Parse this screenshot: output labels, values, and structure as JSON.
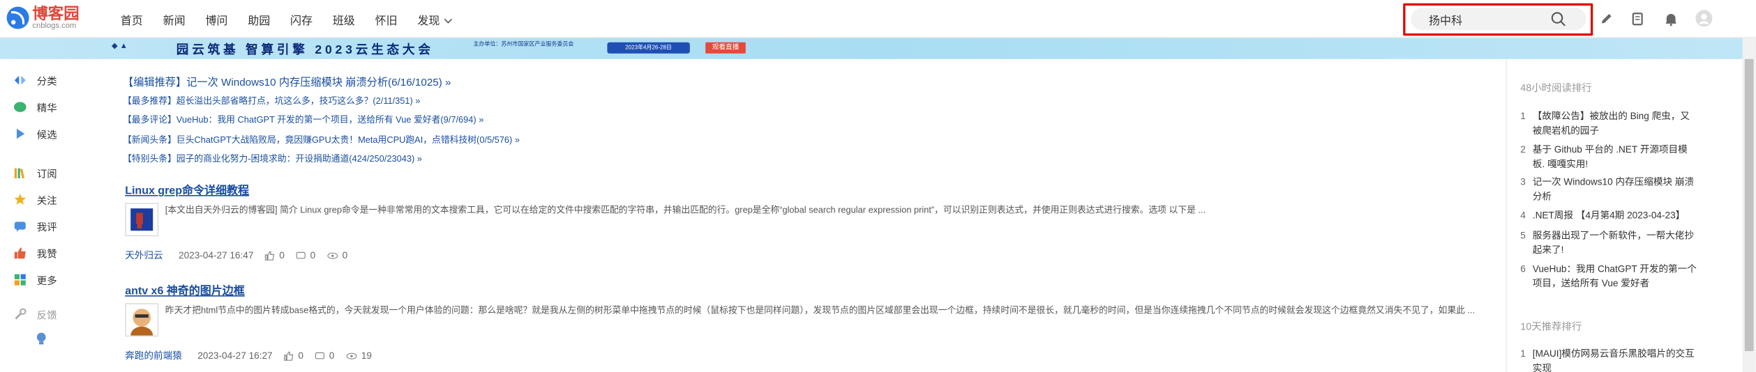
{
  "header": {
    "logo_cn": "博客园",
    "logo_en": "cnblogs.com",
    "nav": [
      "首页",
      "新闻",
      "博问",
      "助园",
      "闪存",
      "班级",
      "怀旧",
      "发现"
    ],
    "search_value": "扬中科",
    "icons": [
      "search-icon",
      "edit-icon",
      "notebook-icon",
      "bell-icon",
      "avatar-icon"
    ]
  },
  "banner": {
    "title": "园云筑基 智算引擎 2023云生态大会",
    "small": "主办单位：苏州市国家区产业服务委员会",
    "date": "2023年4月26-28日",
    "button": "观看直播"
  },
  "left_nav": {
    "items": [
      {
        "label": "分类",
        "icon": "category-icon",
        "color": "#2c7be5"
      },
      {
        "label": "精华",
        "icon": "gem-icon",
        "color": "#3cb371"
      },
      {
        "label": "候选",
        "icon": "play-icon",
        "color": "#4a90e2"
      },
      {
        "label": "订阅",
        "icon": "bookshelf-icon",
        "color": "#f0a020"
      },
      {
        "label": "关注",
        "icon": "star-icon",
        "color": "#f2b21a"
      },
      {
        "label": "我评",
        "icon": "comment-icon",
        "color": "#4a90e2"
      },
      {
        "label": "我赞",
        "icon": "thumb-icon",
        "color": "#e0603b"
      },
      {
        "label": "更多",
        "icon": "more-icon",
        "color": "#3cb371"
      },
      {
        "label": "反馈",
        "icon": "wrench-icon",
        "color": "#aaaaaa"
      }
    ],
    "bulb_icon": "bulb-icon"
  },
  "notices": [
    "【编辑推荐】记一次 Windows10 内存压缩模块 崩溃分析(6/16/1025) »",
    "【最多推荐】超长溢出头部省略打点，坑这么多，技巧这么多？(2/11/351) »",
    "【最多评论】VueHub：我用 ChatGPT 开发的第一个项目，送给所有 Vue 爱好者(9/7/694) »",
    "【新闻头条】巨头ChatGPT大战陷败局，竟因赚GPU太贵！Meta用CPU跑AI，点错科技树(0/5/576) »",
    "【特别头条】园子的商业化努力-困境求助：开设捐助通道(424/250/23043) »"
  ],
  "posts": [
    {
      "title": "Linux grep命令详细教程",
      "summary": "[本文出自天外归云的博客园] 简介 Linux grep命令是一种非常常用的文本搜索工具，它可以在给定的文件中搜索匹配的字符串，并输出匹配的行。grep是全称“global search regular expression print”，可以识别正则表达式，并使用正则表达式进行搜索。选项 以下是 ...",
      "author": "天外归云",
      "date": "2023-04-27 16:47",
      "likes": "0",
      "comments": "0",
      "views": "0"
    },
    {
      "title": "antv x6 神奇的图片边框",
      "summary": "昨天才把html节点中的图片转成base格式的，今天就发现一个用户体验的问题：那么是啥呢？就是我从左侧的树形菜单中拖拽节点的时候（鼠标按下也是同样问题），发现节点的图片区域部里会出现一个边框，持续时间不是很长，就几毫秒的时间，但是当你连续拖拽几个不同节点的时候就会发现这个边框竟然又消失不见了，如果此 ...",
      "author": "奔跑的前端猿",
      "date": "2023-04-27 16:27",
      "likes": "0",
      "comments": "0",
      "views": "19"
    }
  ],
  "right": {
    "hot_title": "48小时阅读排行",
    "hot": [
      {
        "n": "1",
        "t": "【故障公告】被放出的 Bing 爬虫，又被爬岩机的园子"
      },
      {
        "n": "2",
        "t": "基于 Github 平台的 .NET 开源项目模板. 嘎嘎实用!"
      },
      {
        "n": "3",
        "t": "记一次 Windows10 内存压缩模块 崩溃分析"
      },
      {
        "n": "4",
        "t": ".NET周报 【4月第4期 2023-04-23】"
      },
      {
        "n": "5",
        "t": "服务器出现了一个新软件，一帮大佬抄起来了!"
      },
      {
        "n": "6",
        "t": "VueHub：我用 ChatGPT 开发的第一个项目，送给所有 Vue 爱好者"
      }
    ],
    "rec_title": "10天推荐排行",
    "rec": [
      {
        "n": "1",
        "t": "[MAUI]模仿网易云音乐黑胶唱片的交互实现"
      }
    ]
  }
}
